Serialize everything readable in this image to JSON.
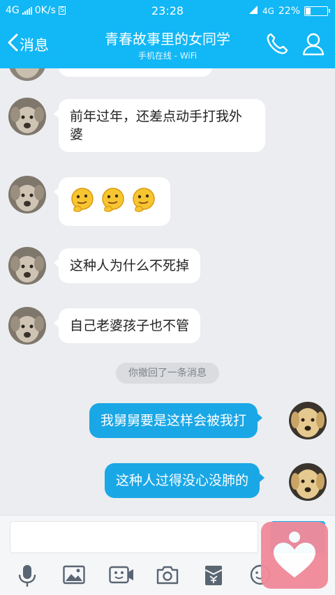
{
  "status_bar": {
    "network_left": "4G",
    "speed": "0K/s",
    "sim_badge": "S",
    "time": "23:28",
    "network_right": "4G",
    "battery": "22%"
  },
  "header": {
    "back_label": "消息",
    "title": "青春故事里的女同学",
    "subtitle": "手机在线 - WiFi"
  },
  "messages": [
    {
      "side": "left",
      "text": "前年过年，还差点动手打我外婆"
    },
    {
      "side": "left",
      "emoji": [
        "thinking-emoji",
        "thinking-emoji",
        "thinking-emoji"
      ]
    },
    {
      "side": "left",
      "text": "这种人为什么不死掉"
    },
    {
      "side": "left",
      "text": "自己老婆孩子也不管"
    },
    {
      "side": "right",
      "text": "我舅舅要是这样会被我打"
    },
    {
      "side": "right",
      "text": "这种人过得没心没肺的"
    }
  ],
  "system_notice": "你撤回了一条消息",
  "input": {
    "value": "",
    "placeholder": ""
  },
  "colors": {
    "accent": "#12b7f5",
    "bubble_right": "#1aa7e6",
    "background": "#ebedf0"
  }
}
